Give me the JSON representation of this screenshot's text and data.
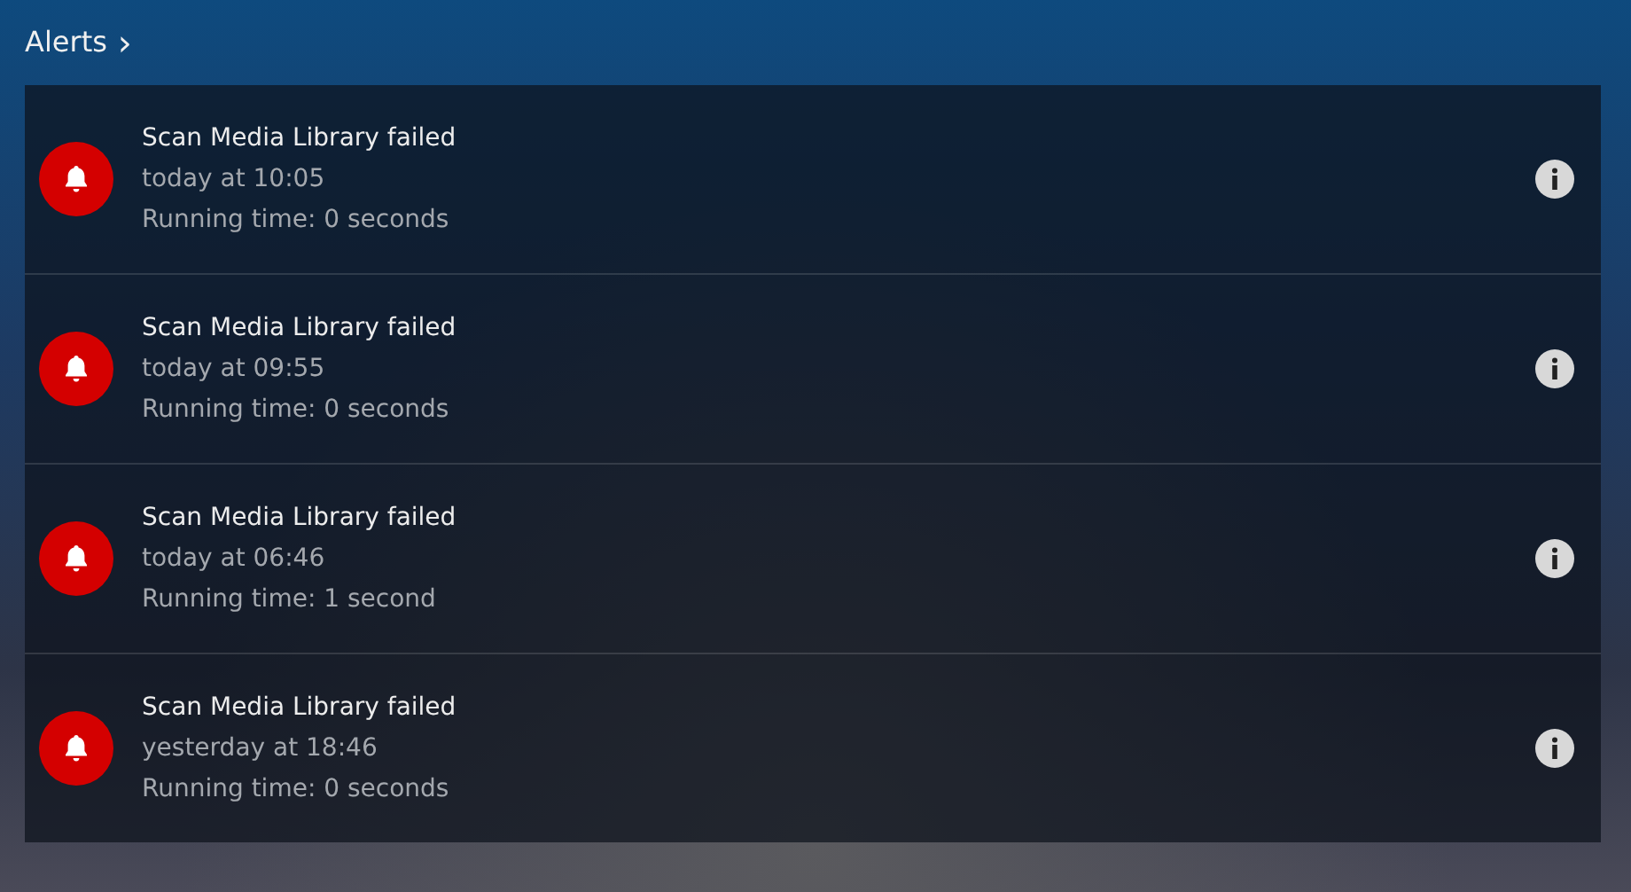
{
  "header": {
    "title": "Alerts",
    "chevron": "›"
  },
  "alerts": [
    {
      "title": "Scan Media Library failed",
      "time": "today at 10:05",
      "detail": "Running time: 0 seconds"
    },
    {
      "title": "Scan Media Library failed",
      "time": "today at 09:55",
      "detail": "Running time: 0 seconds"
    },
    {
      "title": "Scan Media Library failed",
      "time": "today at 06:46",
      "detail": "Running time: 1 second"
    },
    {
      "title": "Scan Media Library failed",
      "time": "yesterday at 18:46",
      "detail": "Running time: 0 seconds"
    }
  ]
}
